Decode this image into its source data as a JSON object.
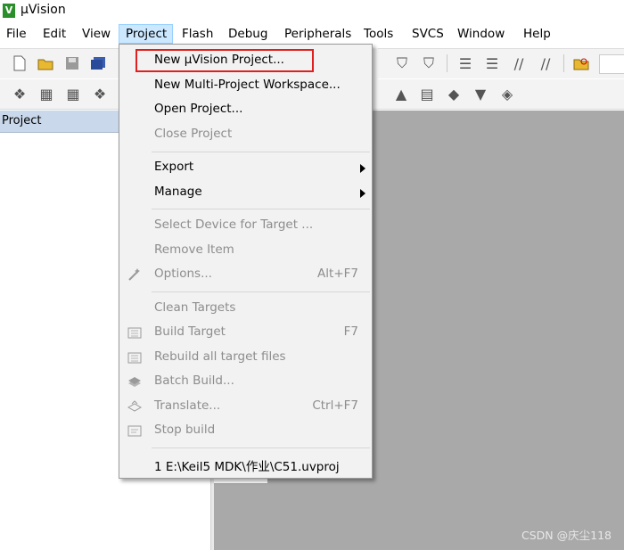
{
  "window": {
    "title": "µVision",
    "app_icon": "keil-uvision-icon"
  },
  "menubar": {
    "items": [
      "File",
      "Edit",
      "View",
      "Project",
      "Flash",
      "Debug",
      "Peripherals",
      "Tools",
      "SVCS",
      "Window",
      "Help"
    ],
    "active": "Project"
  },
  "project_panel": {
    "title": "Project"
  },
  "project_menu": {
    "new_uvision_project": "New µVision Project...",
    "new_multi_project": "New Multi-Project Workspace...",
    "open_project": "Open Project...",
    "close_project": "Close Project",
    "export": "Export",
    "manage": "Manage",
    "select_device": "Select Device for Target ...",
    "remove_item": "Remove Item",
    "options": "Options...",
    "options_shortcut": "Alt+F7",
    "clean_targets": "Clean Targets",
    "build_target": "Build Target",
    "build_target_shortcut": "F7",
    "rebuild_all": "Rebuild all target files",
    "batch_build": "Batch Build...",
    "translate": "Translate...",
    "translate_shortcut": "Ctrl+F7",
    "stop_build": "Stop build",
    "recent_1": "1 E:\\Keil5 MDK\\作业\\C51.uvproj"
  },
  "watermark": "CSDN @庆尘118",
  "colors": {
    "highlight_border": "#e02020",
    "active_menu_bg": "#cce8ff",
    "project_header_bg": "#c9d8ea",
    "editor_bg": "#a9a9a9"
  }
}
